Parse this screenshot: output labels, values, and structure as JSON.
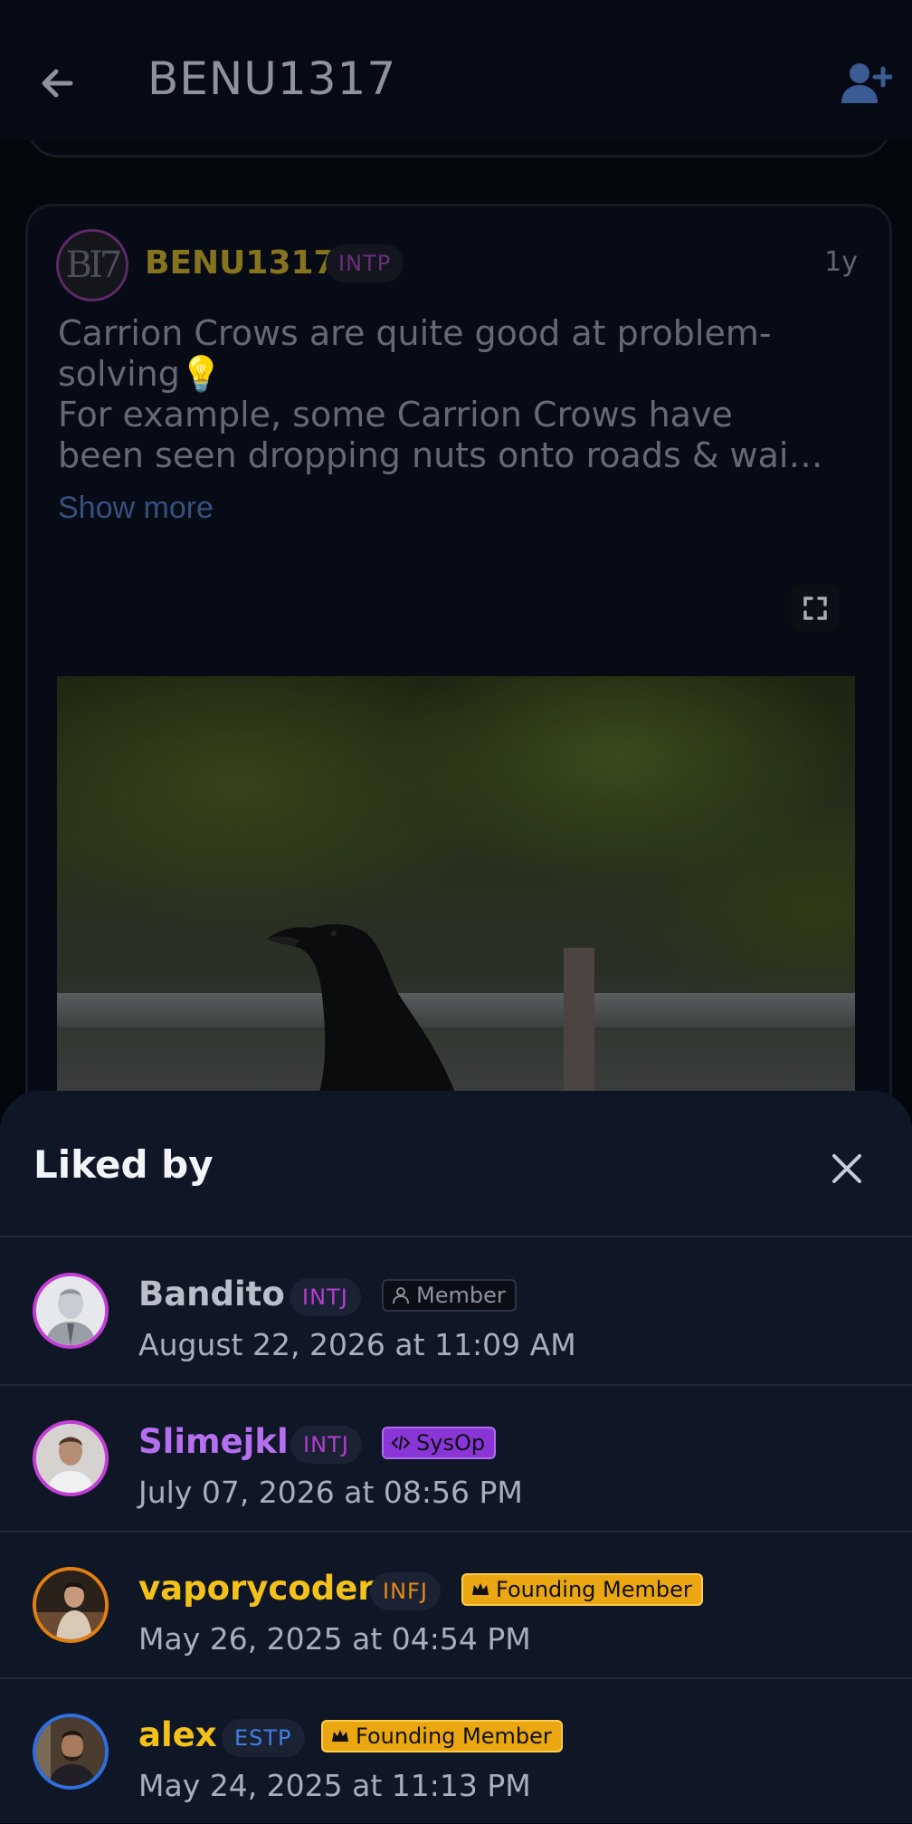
{
  "appbar": {
    "title": "BENU1317",
    "back_icon": "arrow-left-icon",
    "action_icon": "add-user-icon"
  },
  "post": {
    "author": "BENU1317",
    "avatar_text": "BI7",
    "personality": "INTP",
    "time": "1y",
    "text_lines": [
      "Carrion Crows are quite good at problem-",
      "solving💡",
      "For example, some Carrion Crows have",
      "been seen dropping nuts onto roads & wai…"
    ],
    "show_more": "Show more",
    "expand_icon": "fullscreen-icon"
  },
  "sheet": {
    "title": "Liked by",
    "close_icon": "close-icon",
    "likes": [
      {
        "name": "Bandito",
        "type": "INTJ",
        "role": "Member",
        "date": "August 22, 2026 at 11:09 AM",
        "name_color": "#b9bec8",
        "type_color": "#b23fcf",
        "ring_color": "#c23fd6"
      },
      {
        "name": "Slimejkl",
        "type": "INTJ",
        "role": "SysOp",
        "date": "July 07, 2026 at 08:56 PM",
        "name_color": "#b66ff0",
        "type_color": "#b23fcf",
        "ring_color": "#c23fd6"
      },
      {
        "name": "vaporycoder",
        "type": "INFJ",
        "role": "Founding Member",
        "date": "May 26, 2025 at 04:54 PM",
        "name_color": "#f3c21a",
        "type_color": "#e68a1a",
        "ring_color": "#e07f12"
      },
      {
        "name": "alex",
        "type": "ESTP",
        "role": "Founding Member",
        "date": "May 24, 2025 at 11:13 PM",
        "name_color": "#f3c21a",
        "type_color": "#3f7fe6",
        "ring_color": "#2f6fe0"
      }
    ]
  },
  "colors": {
    "accent_blue": "#3a5b94",
    "sheet_bg": "#0f1626",
    "founder_gold": "#eaa711",
    "sysop_purple": "#8a35d6"
  }
}
